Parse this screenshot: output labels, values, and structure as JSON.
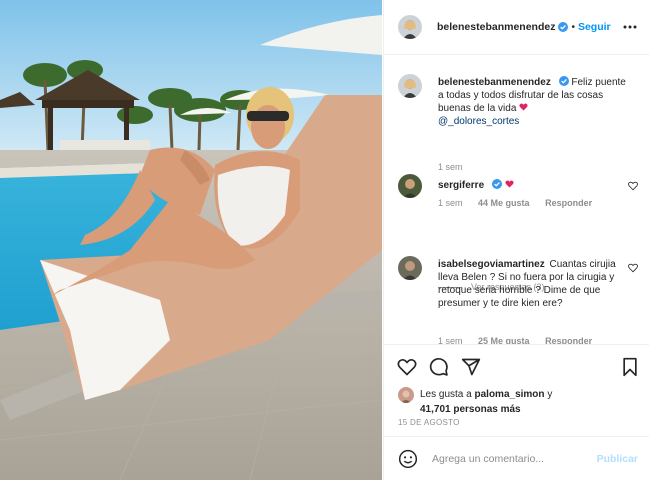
{
  "header": {
    "username": "belenestebanmenendez",
    "follow_label": "Seguir",
    "separator": "•"
  },
  "caption": {
    "username": "belenestebanmenendez",
    "text": "Feliz puente a todas y todos disfrutar de las cosas buenas de la vida",
    "mention": "@_dolores_cortes",
    "time": "1 sem"
  },
  "comments": [
    {
      "username": "sergiferre",
      "text": "",
      "time": "1 sem",
      "likes": "44 Me gusta",
      "reply": "Responder",
      "view_replies": "Ver respuestas (3)"
    },
    {
      "username": "isabelsegoviamartinez",
      "text": "Cuantas cirujia lleva Belen ? Si no fuera por la cirugia y retoque seria horrible ? Dime de que presumer y te dire kien ere?",
      "time": "1 sem",
      "likes": "25 Me gusta",
      "reply": "Responder"
    }
  ],
  "likes": {
    "prefix": "Les gusta a",
    "user": "paloma_simon",
    "middle": "y",
    "count": "41,701 personas más"
  },
  "date": "15 DE AGOSTO",
  "add_comment": {
    "placeholder": "Agrega un comentario...",
    "publish_label": "Publicar"
  },
  "colors": {
    "accent": "#0095f6",
    "publish_disabled": "#b2dffc",
    "muted": "#8e8e8e",
    "text": "#262626"
  },
  "icons": [
    "verified-badge-icon",
    "more-options-icon",
    "heart-icon",
    "comment-icon",
    "share-icon",
    "bookmark-icon",
    "emoji-icon"
  ]
}
